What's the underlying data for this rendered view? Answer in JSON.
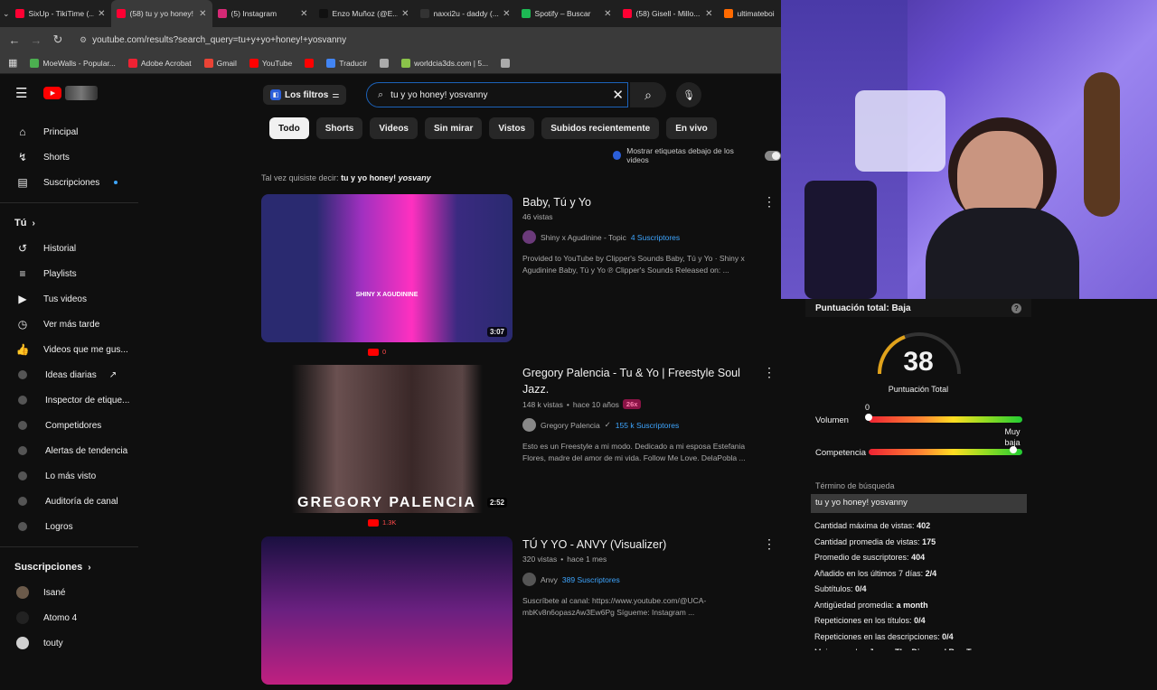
{
  "tabs": [
    {
      "title": "SixUp - TikiTime (...",
      "color": "#ff0033"
    },
    {
      "title": "(58) tu y yo honey!",
      "color": "#ff0033",
      "active": true
    },
    {
      "title": "(5) Instagram",
      "color": "#d62976"
    },
    {
      "title": "Enzo Muñoz (@E...",
      "color": "#111111"
    },
    {
      "title": "naxxi2u - daddy (...",
      "color": "#333333"
    },
    {
      "title": "Spotify – Buscar",
      "color": "#1db954"
    },
    {
      "title": "(58) Gisell - Millo...",
      "color": "#ff0033"
    },
    {
      "title": "ultimateboi",
      "color": "#ff6a00"
    }
  ],
  "address": {
    "url": "youtube.com/results?search_query=tu+y+yo+honey!+yosvanny"
  },
  "bookmarks": [
    {
      "label": "MoeWalls - Popular...",
      "color": "#4caf50"
    },
    {
      "label": "Adobe Acrobat",
      "color": "#e23"
    },
    {
      "label": "Gmail",
      "color": "#ea4335"
    },
    {
      "label": "YouTube",
      "color": "#ff0000"
    },
    {
      "label": "",
      "color": "#ff0000"
    },
    {
      "label": "Traducir",
      "color": "#4285f4"
    },
    {
      "label": "",
      "color": "#aaaaaa"
    },
    {
      "label": "worldcia3ds.com | 5...",
      "color": "#8bc34a"
    },
    {
      "label": "",
      "color": "#aaaaaa"
    }
  ],
  "sidebar": {
    "main": [
      {
        "label": "Principal",
        "icon": "home-icon",
        "glyph": "⌂"
      },
      {
        "label": "Shorts",
        "icon": "shorts-icon",
        "glyph": "↯"
      },
      {
        "label": "Suscripciones",
        "icon": "subscriptions-icon",
        "glyph": "▤"
      }
    ],
    "you_heading": "Tú",
    "you": [
      {
        "label": "Historial",
        "icon": "history-icon",
        "glyph": "↺"
      },
      {
        "label": "Playlists",
        "icon": "playlists-icon",
        "glyph": "≡"
      },
      {
        "label": "Tus videos",
        "icon": "your-videos-icon",
        "glyph": "▶"
      },
      {
        "label": "Ver más tarde",
        "icon": "watch-later-icon",
        "glyph": "◷"
      },
      {
        "label": "Videos que me gus...",
        "icon": "liked-icon",
        "glyph": "👍"
      }
    ],
    "tools": [
      {
        "label": "Ideas diarias",
        "icon": "ideas-icon"
      },
      {
        "label": "Inspector de etique...",
        "icon": "tag-inspector-icon"
      },
      {
        "label": "Competidores",
        "icon": "competitors-icon"
      },
      {
        "label": "Alertas de tendencia",
        "icon": "trend-alerts-icon"
      },
      {
        "label": "Lo más visto",
        "icon": "most-viewed-icon"
      },
      {
        "label": "Auditoría de canal",
        "icon": "channel-audit-icon"
      },
      {
        "label": "Logros",
        "icon": "achievements-icon"
      }
    ],
    "subs_heading": "Suscripciones",
    "subs": [
      {
        "label": "Isané",
        "color": "#6b5a4a"
      },
      {
        "label": "Atomo 4",
        "color": "#222222"
      },
      {
        "label": "touty",
        "color": "#d0d0d0"
      }
    ]
  },
  "search": {
    "filters_label": "Los filtros",
    "query": "tu y yo honey! yosvanny"
  },
  "chips": [
    "Todo",
    "Shorts",
    "Videos",
    "Sin mirar",
    "Vistos",
    "Subidos recientemente",
    "En vivo"
  ],
  "labels_toggle": "Mostrar etiquetas debajo de los videos",
  "did_you_mean": {
    "prefix": "Tal vez quisiste decir:",
    "plain": "tu y yo honey!",
    "italic": "yosvany"
  },
  "videos": [
    {
      "title": "Baby, Tú y Yo",
      "meta": "46 vistas",
      "ago": "",
      "badge": "",
      "channel": "Shiny x Agudinine - Topic",
      "subs": "4 Suscriptores",
      "verified": false,
      "desc": "Provided to YouTube by Clipper's Sounds Baby, Tú y Yo · Shiny x Agudinine Baby, Tú y Yo ℗ Clipper's Sounds Released on: ...",
      "duration": "3:07",
      "yt_views": "0",
      "thumb_text": "SHINY X AGUDININE",
      "ch_color": "#6b3a7a"
    },
    {
      "title": "Gregory Palencia - Tu & Yo | Freestyle Soul Jazz.",
      "meta": "148 k vistas",
      "ago": "hace 10 años",
      "badge": "26x",
      "channel": "Gregory Palencia",
      "subs": "155 k Suscriptores",
      "verified": true,
      "desc": "Esto es un Freestyle a mi modo. Dedicado a mi esposa Estefania Flores, madre del amor de mi vida. Follow Me Love. DelaPobla ...",
      "duration": "2:52",
      "yt_views": "1.3K",
      "thumb_text": "GREGORY PALENCIA",
      "ch_color": "#888888"
    },
    {
      "title": "TÚ Y YO - ANVY (Visualizer)",
      "meta": "320 vistas",
      "ago": "hace 1 mes",
      "badge": "",
      "channel": "Anvy",
      "subs": "389 Suscriptores",
      "verified": false,
      "desc": "Suscríbete al canal: https://www.youtube.com/@UCA-mbKv8n6opaszAw3Ew6Pg Sígueme: Instagram ...",
      "duration": "",
      "yt_views": "",
      "thumb_text": "",
      "ch_color": "#555555"
    }
  ],
  "panel": {
    "header": "Puntuación total: Baja",
    "score": "38",
    "score_label": "Puntuación Total",
    "volume_label": "Volumen",
    "volume_value": "0",
    "volume_level": "Muy baja",
    "competition_label": "Competencia",
    "term_label": "Término de búsqueda",
    "term": "tu y yo honey! yosvanny",
    "stats": [
      {
        "k": "Cantidad máxima de vistas:",
        "v": "402"
      },
      {
        "k": "Cantidad promedia de vistas:",
        "v": "175"
      },
      {
        "k": "Promedio de suscriptores:",
        "v": "404"
      },
      {
        "k": "Añadido en los últimos 7 días:",
        "v": "2/4"
      },
      {
        "k": "Subtítulos:",
        "v": "0/4"
      },
      {
        "k": "Antigüedad promedia:",
        "v": "a month"
      },
      {
        "k": "Repeticiones en los títulos:",
        "v": "0/4"
      },
      {
        "k": "Repeticiones en las descripciones:",
        "v": "0/4"
      },
      {
        "k": "Mejor creador:",
        "v": "Jowar The Diamond Boy Tema"
      }
    ]
  },
  "colors": {
    "accent": "#3ea6ff",
    "youtube_red": "#ff0000"
  }
}
